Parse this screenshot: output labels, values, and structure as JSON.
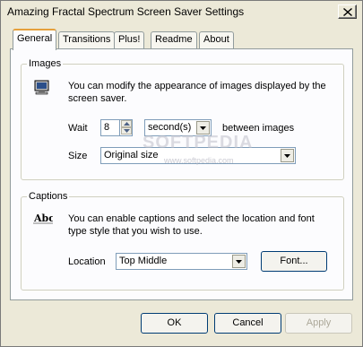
{
  "window": {
    "title": "Amazing Fractal Spectrum Screen Saver Settings"
  },
  "tabs": [
    {
      "label": "General",
      "active": true
    },
    {
      "label": "Transitions",
      "active": false
    },
    {
      "label": "Plus!",
      "active": false
    },
    {
      "label": "Readme",
      "active": false
    },
    {
      "label": "About",
      "active": false
    }
  ],
  "images_group": {
    "legend": "Images",
    "icon": "monitor-icon",
    "description": "You can modify the appearance of images displayed by the screen saver.",
    "wait_label": "Wait",
    "wait_value": "8",
    "wait_unit": "second(s)",
    "between_label": "between images",
    "size_label": "Size",
    "size_value": "Original size"
  },
  "captions_group": {
    "legend": "Captions",
    "icon": "text-abc-icon",
    "description": "You can enable captions and select the location and font type style that you wish to use.",
    "location_label": "Location",
    "location_value": "Top Middle",
    "font_button": "Font..."
  },
  "watermark": {
    "text": "SOFTPEDIA",
    "sub": "www.softpedia.com"
  },
  "buttons": {
    "ok": "OK",
    "cancel": "Cancel",
    "apply": "Apply"
  },
  "colors": {
    "dialog_bg": "#ece9d8",
    "panel_bg": "#fcfcfe",
    "active_tab_accent": "#e6a03c",
    "input_border": "#7f9db9"
  }
}
